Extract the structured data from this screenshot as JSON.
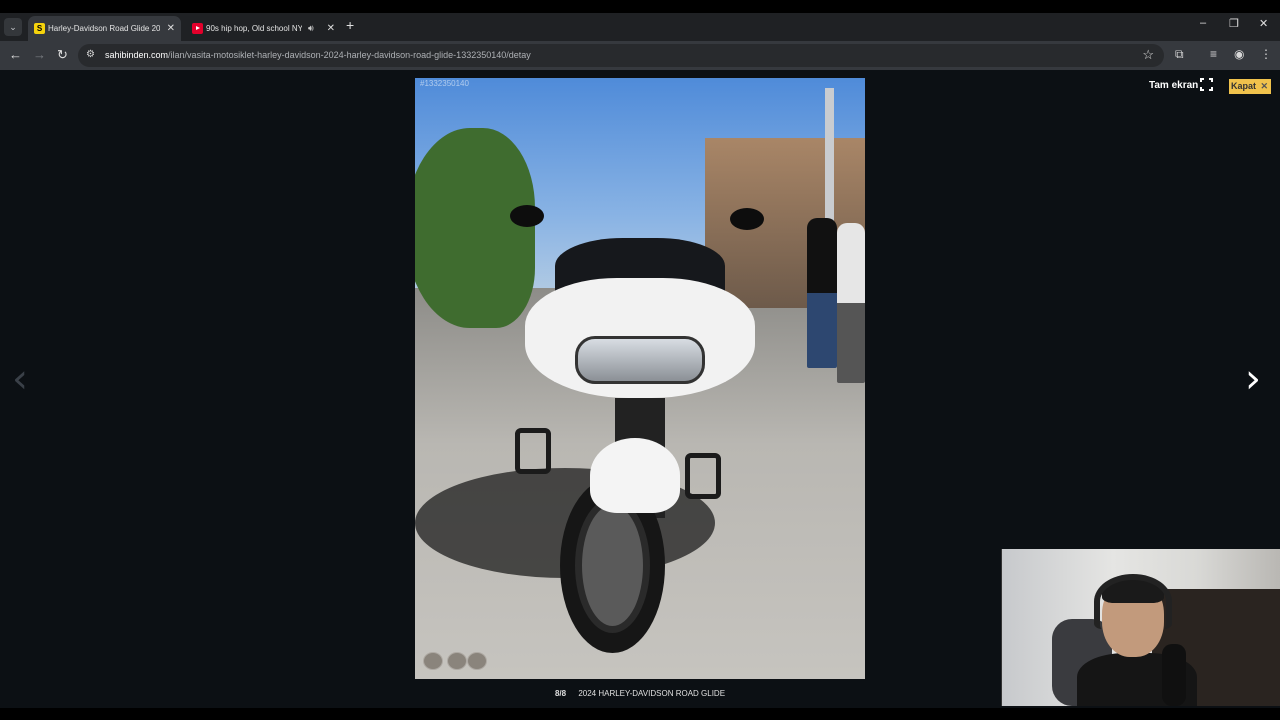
{
  "browser": {
    "tabs": [
      {
        "title": "Harley-Davidson Road Glide 20",
        "favicon": "S",
        "active": true
      },
      {
        "title": "90s hip hop, Old school NY",
        "favicon": "youtube-icon",
        "active": false
      }
    ],
    "url_host": "sahibinden.com",
    "url_path": "/ilan/vasita-motosiklet-harley-davidson-2024-harley-davidson-road-glide-1332350140/detay"
  },
  "viewer": {
    "fullscreen_label": "Tam ekran",
    "close_label": "Kapat",
    "photo_counter": "8/8",
    "photo_caption": "2024 HARLEY-DAVIDSON ROAD GLIDE",
    "watermark": "#1332350140"
  },
  "colors": {
    "close_button": "#f0c24c",
    "viewer_background": "#0c1014",
    "browser_toolbar": "#36393e"
  }
}
